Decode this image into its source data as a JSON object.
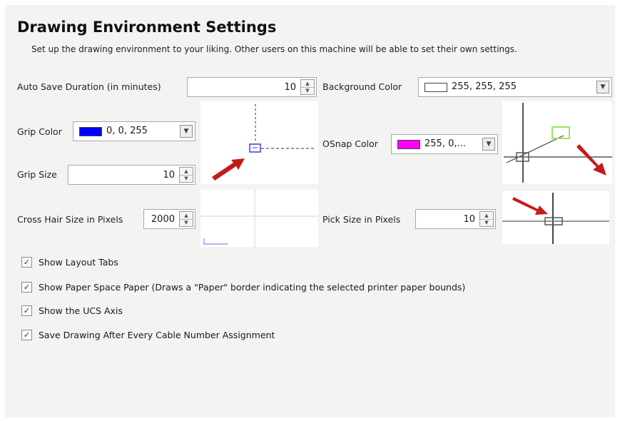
{
  "header": {
    "title": "Drawing Environment Settings",
    "subtitle": "Set up the drawing environment to your liking. Other users on this machine will be able to set their own settings."
  },
  "auto_save": {
    "label": "Auto Save Duration (in minutes)",
    "value": "10"
  },
  "background_color": {
    "label": "Background Color",
    "value": "255, 255, 255",
    "swatch": "#ffffff"
  },
  "grip_color": {
    "label": "Grip Color",
    "value": "0, 0, 255",
    "swatch": "#0000ff"
  },
  "grip_size": {
    "label": "Grip Size",
    "value": "10"
  },
  "osnap_color": {
    "label": "OSnap Color",
    "value": "255, 0,...",
    "swatch": "#ff00ff"
  },
  "cross_hair": {
    "label": "Cross Hair Size in Pixels",
    "value": "2000"
  },
  "pick_size": {
    "label": "Pick Size in Pixels",
    "value": "10"
  },
  "options": [
    {
      "label": "Show Layout Tabs",
      "checked": true
    },
    {
      "label": "Show Paper Space Paper (Draws a \"Paper\" border indicating the selected printer paper bounds)",
      "checked": true
    },
    {
      "label": "Show the UCS Axis",
      "checked": true
    },
    {
      "label": "Save Drawing After Every Cable Number Assignment",
      "checked": true
    }
  ],
  "icons": {
    "spin_up": "▲",
    "spin_down": "▼",
    "dropdown": "▼",
    "check": "✓"
  },
  "colors": {
    "panel": "#f3f3f1",
    "arrow": "#c41a1a",
    "osnap_marker": "#99e65c"
  }
}
